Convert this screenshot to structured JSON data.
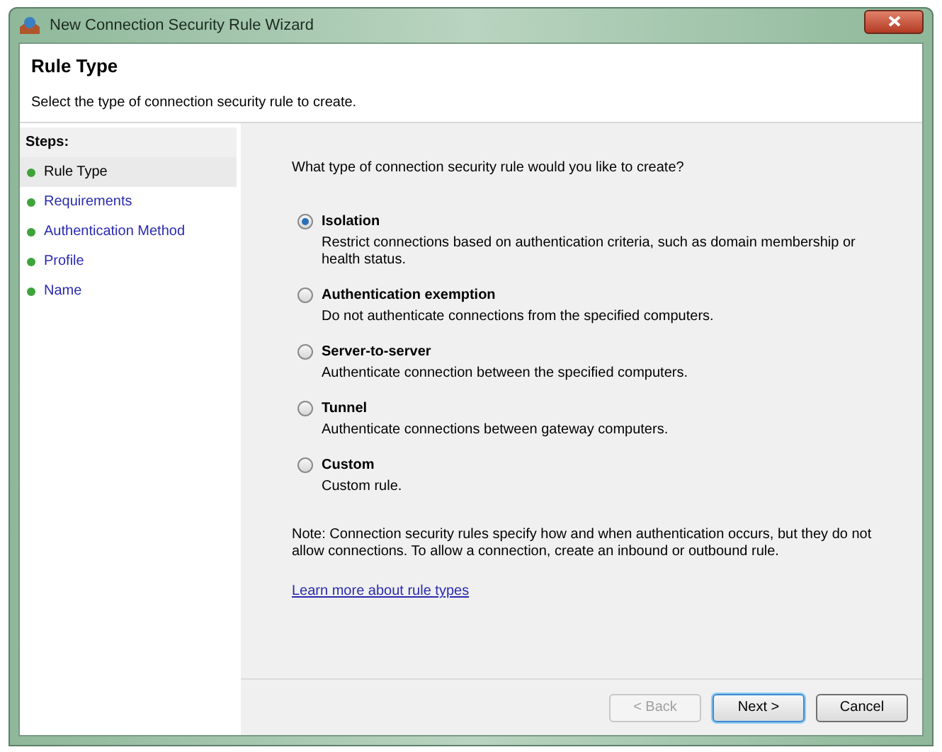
{
  "window": {
    "title": "New Connection Security Rule Wizard"
  },
  "header": {
    "title": "Rule Type",
    "subtitle": "Select the type of connection security rule to create."
  },
  "steps": {
    "heading": "Steps:",
    "items": [
      {
        "label": "Rule Type",
        "selected": true
      },
      {
        "label": "Requirements",
        "selected": false
      },
      {
        "label": "Authentication Method",
        "selected": false
      },
      {
        "label": "Profile",
        "selected": false
      },
      {
        "label": "Name",
        "selected": false
      }
    ]
  },
  "question": "What type of connection security rule would you like to create?",
  "options": [
    {
      "label": "Isolation",
      "description": "Restrict connections based on authentication criteria, such as domain membership or health status.",
      "selected": true
    },
    {
      "label": "Authentication exemption",
      "description": "Do not authenticate connections from the specified computers.",
      "selected": false
    },
    {
      "label": "Server-to-server",
      "description": "Authenticate connection between the specified computers.",
      "selected": false
    },
    {
      "label": "Tunnel",
      "description": "Authenticate connections between gateway computers.",
      "selected": false
    },
    {
      "label": "Custom",
      "description": "Custom rule.",
      "selected": false
    }
  ],
  "note": "Note:  Connection security rules specify how and when authentication occurs, but they do not allow connections.  To allow a connection, create an inbound or outbound rule.",
  "link": "Learn more about rule types",
  "buttons": [
    {
      "label": "< Back",
      "disabled": true,
      "default": false
    },
    {
      "label": "Next >",
      "disabled": false,
      "default": true
    },
    {
      "label": "Cancel",
      "disabled": false,
      "default": false
    }
  ]
}
